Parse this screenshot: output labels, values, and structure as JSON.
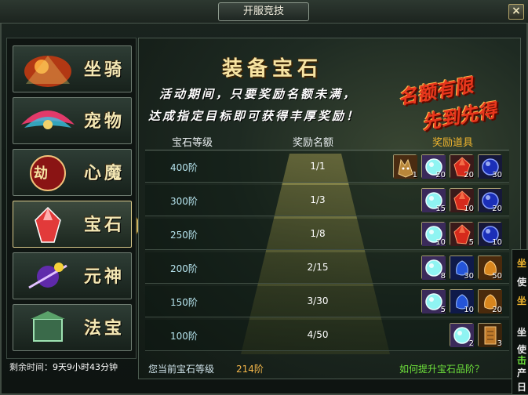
{
  "window": {
    "title": "开服竞技",
    "close_label": "×"
  },
  "sidebar": {
    "items": [
      {
        "label": "坐骑",
        "icon": "mount-icon",
        "active": false
      },
      {
        "label": "宠物",
        "icon": "pet-icon",
        "active": false
      },
      {
        "label": "心魔",
        "icon": "demon-icon",
        "active": false,
        "emblem": "劫"
      },
      {
        "label": "宝石",
        "icon": "gem-icon",
        "active": true
      },
      {
        "label": "元神",
        "icon": "spirit-icon",
        "active": false
      },
      {
        "label": "法宝",
        "icon": "artifact-icon",
        "active": false
      }
    ],
    "remain_label": "剩余时间：",
    "remain_value": "9天9小时43分钟"
  },
  "main": {
    "title": "装备宝石",
    "desc_line1": "活动期间，只要奖励名额未满，",
    "desc_line2": "达成指定目标即可获得丰厚奖励！",
    "promo_line1": "名额有限",
    "promo_line2": "先到先得",
    "table": {
      "headers": [
        "宝石等级",
        "奖励名额",
        "奖励道具"
      ],
      "rows": [
        {
          "level": "400阶",
          "quota": "1/1",
          "items": [
            {
              "icon": "wolf-icon",
              "count": "1"
            },
            {
              "icon": "cyan-orb-icon",
              "count": "20"
            },
            {
              "icon": "red-gem-icon",
              "count": "20"
            },
            {
              "icon": "blue-orb-icon",
              "count": "30"
            }
          ]
        },
        {
          "level": "300阶",
          "quota": "1/3",
          "items": [
            {
              "icon": "cyan-orb-icon",
              "count": "15"
            },
            {
              "icon": "red-gem-icon",
              "count": "10"
            },
            {
              "icon": "blue-orb-icon",
              "count": "20"
            }
          ]
        },
        {
          "level": "250阶",
          "quota": "1/8",
          "items": [
            {
              "icon": "cyan-orb-icon",
              "count": "10"
            },
            {
              "icon": "red-gem-icon",
              "count": "5"
            },
            {
              "icon": "blue-orb-icon",
              "count": "10"
            }
          ]
        },
        {
          "level": "200阶",
          "quota": "2/15",
          "items": [
            {
              "icon": "cyan-orb-icon",
              "count": "8"
            },
            {
              "icon": "blue-spirit-icon",
              "count": "30"
            },
            {
              "icon": "orange-spirit-icon",
              "count": "50"
            }
          ]
        },
        {
          "level": "150阶",
          "quota": "3/30",
          "items": [
            {
              "icon": "cyan-orb-icon",
              "count": "5"
            },
            {
              "icon": "blue-spirit-icon",
              "count": "10"
            },
            {
              "icon": "orange-spirit-icon",
              "count": "20"
            }
          ]
        },
        {
          "level": "100阶",
          "quota": "4/50",
          "items": [
            {
              "icon": "cyan-orb-icon",
              "count": "2"
            },
            {
              "icon": "scroll-icon",
              "count": "3"
            }
          ]
        }
      ]
    },
    "current_label": "您当前宝石等级",
    "current_value": "214阶",
    "help_link": "如何提升宝石品阶？"
  },
  "tooltip_fragment": {
    "chars": [
      {
        "text": "坐",
        "color": "#f0b52e"
      },
      {
        "text": "使",
        "color": "#e6e6e6"
      },
      {
        "text": "坐",
        "color": "#f0b52e"
      },
      {
        "text": "坐",
        "color": "#e6e6e6"
      },
      {
        "text": "使",
        "color": "#e6e6e6"
      },
      {
        "text": "击",
        "color": "#6ee13b"
      },
      {
        "text": "产",
        "color": "#e6e6e6"
      },
      {
        "text": "日",
        "color": "#e6e6e6"
      }
    ]
  },
  "colors": {
    "accent_gold": "#f0b52e",
    "link_green": "#6ee13b",
    "promo_red": "#e8361c"
  }
}
